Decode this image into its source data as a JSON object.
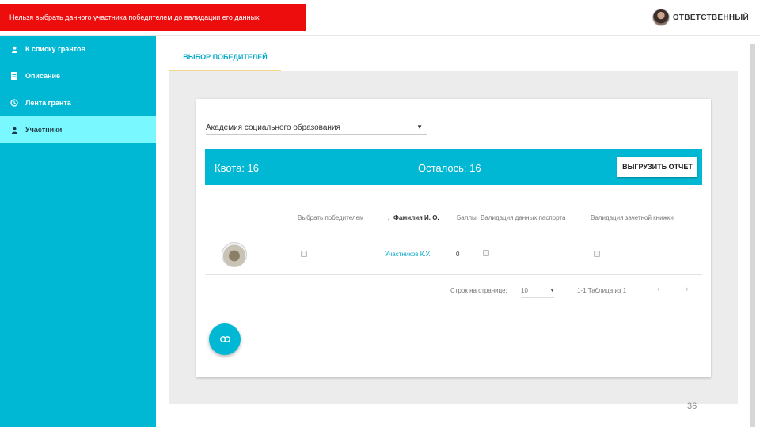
{
  "alert": {
    "message": "Нельзя выбрать данного участника победителем до валидации его данных"
  },
  "user": {
    "label": "ОТВЕТСТВЕННЫЙ"
  },
  "sidebar": {
    "items": [
      {
        "label": "К списку грантов",
        "icon": "person-icon"
      },
      {
        "label": "Описание",
        "icon": "document-icon"
      },
      {
        "label": "Лента гранта",
        "icon": "clock-icon"
      },
      {
        "label": "Участники",
        "icon": "person-icon",
        "active": true
      }
    ]
  },
  "tabs": {
    "winner_select": "ВЫБОР ПОБЕДИТЕЛЕЙ"
  },
  "card": {
    "select_value": "Академия социального образования",
    "quota_label": "Квота: 16",
    "remaining_label": "Осталось: 16",
    "report_button": "ВЫГРУЗИТЬ ОТЧЕТ",
    "table": {
      "headers": {
        "select_winner": "Выбрать победителем",
        "sort_arrow": "↓",
        "name": "Фамилия И. О.",
        "points": "Баллы",
        "passport_validation": "Валидация данных паспорта",
        "gradebook_validation": "Валидация зачетной книжки"
      },
      "rows": [
        {
          "name": "Участников К.У.",
          "points": "0",
          "select_winner": false,
          "passport_validation": false,
          "gradebook_validation": false
        }
      ]
    },
    "pagination": {
      "rows_per_page_label": "Строк на странице:",
      "rows_per_page_value": "10",
      "range": "1-1 Таблица из 1",
      "prev": "‹",
      "next": "›"
    }
  },
  "slide_number": "36",
  "colors": {
    "accent": "#00b7d4",
    "active_nav": "#7af8ff",
    "alert": "#ee0d0d"
  }
}
